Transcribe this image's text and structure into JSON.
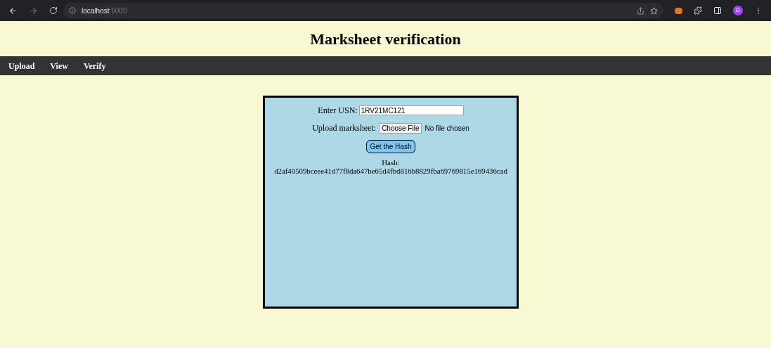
{
  "browser": {
    "url_host": "localhost",
    "url_port": ":5000",
    "avatar": "D"
  },
  "page": {
    "title": "Marksheet verification"
  },
  "nav": [
    {
      "label": "Upload"
    },
    {
      "label": "View"
    },
    {
      "label": "Verify"
    }
  ],
  "form": {
    "usn_label": "Enter USN:",
    "usn_value": "1RV21MC121",
    "upload_label": "Upload marksheet:",
    "choose_button": "Choose File",
    "file_status": "No file chosen",
    "submit": "Get the Hash",
    "hash_label": "Hash:",
    "hash_value": "d2af40509bceee41d77f8da647be65d4fbd816b8829fba69769815e169436cad"
  }
}
